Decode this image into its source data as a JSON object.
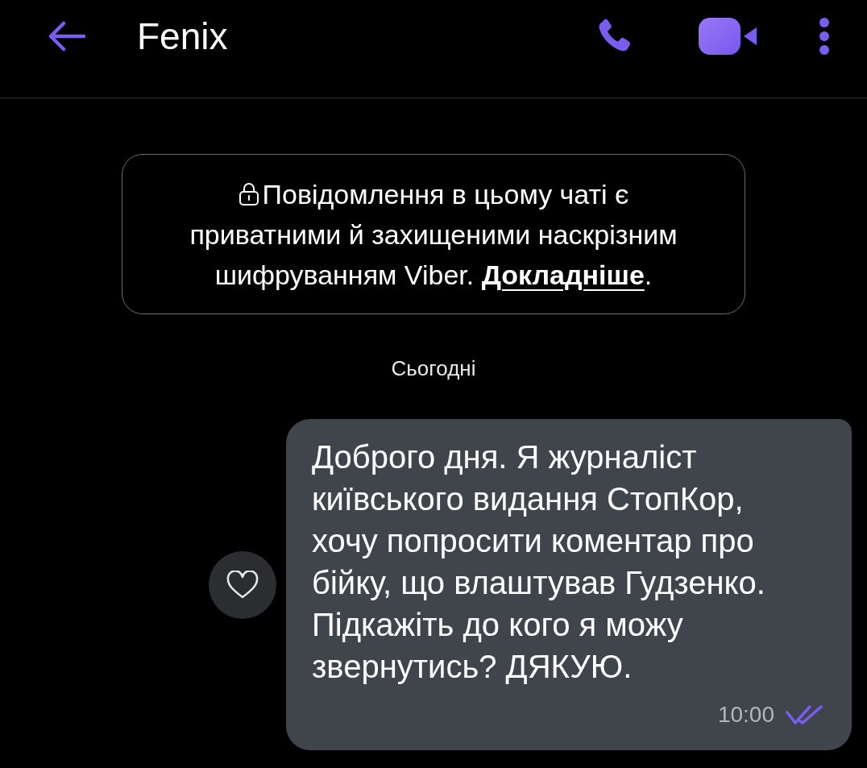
{
  "header": {
    "title": "Fenix"
  },
  "notice": {
    "text": "Повідомлення в цьому чаті є приватними й захищеними наскрізним шифруванням Viber.",
    "link": "Докладніше",
    "after": "."
  },
  "date_divider": "Сьогодні",
  "messages": [
    {
      "text": "Доброго дня. Я журналіст київського видання СтопКор, хочу попросити коментар про бійку, що влаштував Гудзенко. Підкажіть до кого я можу звернутись? ДЯКУЮ.",
      "time": "10:00",
      "seen": true,
      "liked": false
    }
  ]
}
